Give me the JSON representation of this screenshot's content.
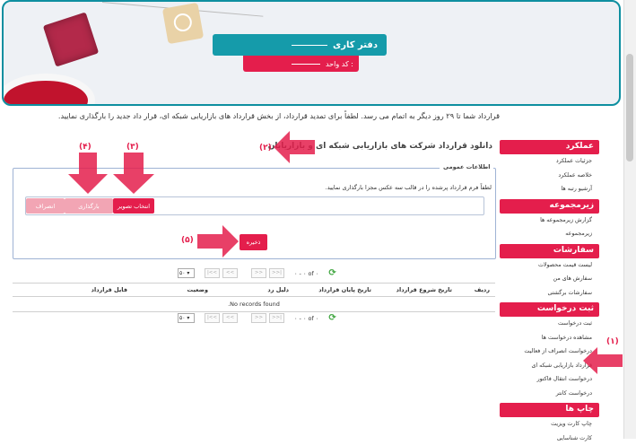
{
  "banner": {
    "title": "دفتر کاری",
    "subtitle_label": "کد واحد :"
  },
  "notice": "قرارداد شما تا ۲۹ روز دیگر به اتمام می رسد. لطفاً برای تمدید قرارداد، از بخش قرارداد های بازاریابی شبکه ای، قرار داد جدید را بارگذاری نمایید.",
  "page_title": "دانلود قرارداد شرکت های بازاریابی شبکه ای و بازاریابان",
  "form": {
    "legend": "اطلاعات عمومی",
    "instruction": "لطفاً فرم قرارداد پرشده را در قالب سه عکس مجزا بارگذاری نمایید.",
    "choose_label": "انتخاب تصویر",
    "upload_label": "بارگذاری",
    "cancel_label": "انصراف",
    "save_label": "ذخیره"
  },
  "pager": {
    "page_size": "۵۰",
    "first": "|<<",
    "prev": "<<",
    "next": ">>",
    "last": ">>|",
    "info": "۰ - ۰ of ۰"
  },
  "table": {
    "headers": [
      "ردیف",
      "تاریخ شروع قرارداد",
      "تاریخ پایان قرارداد",
      "دلیل رد",
      "وضعیت",
      "فایل قرارداد"
    ],
    "empty_message": "No records found."
  },
  "sidebar": {
    "sections": [
      {
        "title": "عملکرد",
        "items": [
          "جزئیات عملکرد",
          "خلاصه عملکرد",
          "آرشیو رتبه ها"
        ]
      },
      {
        "title": "زیرمجموعه",
        "items": [
          "گزارش زیرمجموعه ها",
          "زیرمجموعه"
        ]
      },
      {
        "title": "سفارشات",
        "items": [
          "لیست قیمت محصولات",
          "سفارش های من",
          "سفارشات برگشتی"
        ]
      },
      {
        "title": "ثبت درخواست",
        "items": [
          "ثبت درخواست",
          "مشاهده درخواست ها",
          "درخواست انصراف از فعالیت",
          "قرارداد بازاریابی شبکه ای",
          "درخواست انتقال فاکتور",
          "درخواست کانتر"
        ]
      },
      {
        "title": "چاپ ها",
        "items": [
          "چاپ کارت ویزیت",
          "کارت شناسایی"
        ]
      }
    ]
  },
  "annotations": {
    "n1": "(۱)",
    "n2": "(۲)",
    "n3": "(۳)",
    "n4": "(۴)",
    "n5": "(۵)"
  },
  "colors": {
    "accent_red": "#e41e4c",
    "teal": "#159baa",
    "border_blue": "#9fb3d4"
  }
}
